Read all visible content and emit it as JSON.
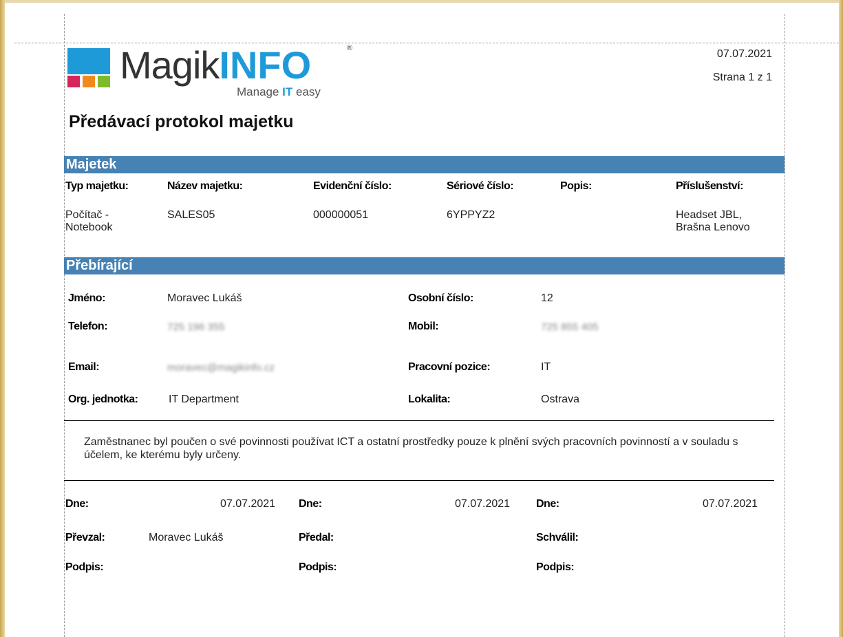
{
  "header": {
    "date": "07.07.2021",
    "page": "Strana 1 z 1"
  },
  "logo": {
    "brand_main": "Magik",
    "brand_accent": "INFO",
    "registered": "®",
    "tagline_pre": "Manage ",
    "tagline_it": "IT",
    "tagline_post": " easy",
    "colors": {
      "blue": "#1f9ad8",
      "red": "#d6245c",
      "orange": "#f08a1c",
      "green": "#7dbb2a"
    }
  },
  "title": "Předávací protokol majetku",
  "asset_section": {
    "heading": "Majetek",
    "columns": [
      "Typ majetku:",
      "Název majetku:",
      "Evidenční číslo:",
      "Sériové číslo:",
      "Popis:",
      "Příslušenství:"
    ],
    "row": {
      "type": "Počítač - Notebook",
      "name": "SALES05",
      "evidence_no": "000000051",
      "serial_no": "6YPPYZ2",
      "description": "",
      "accessories": "Headset JBL, Brašna Lenovo"
    }
  },
  "recipient_section": {
    "heading": "Přebírající",
    "name_label": "Jméno:",
    "name_value": "Moravec Lukáš",
    "personal_no_label": "Osobní číslo:",
    "personal_no_value": "12",
    "phone_label": "Telefon:",
    "phone_value": "725 196 355",
    "mobile_label": "Mobil:",
    "mobile_value": "725 855 405",
    "email_label": "Email:",
    "email_value": "moravec@magikinfo.cz",
    "position_label": "Pracovní pozice:",
    "position_value": "IT",
    "org_label": "Org. jednotka:",
    "org_value": "IT Department",
    "location_label": "Lokalita:",
    "location_value": "Ostrava"
  },
  "note": "Zaměstnanec byl poučen o své povinnosti používat ICT a ostatní prostředky pouze k plnění svých pracovních povinností a v souladu s účelem, ke kterému byly určeny.",
  "signatures": {
    "date_label": "Dne:",
    "date_value": "07.07.2021",
    "received_label": "Převzal:",
    "received_value": "Moravec Lukáš",
    "handed_label": "Předal:",
    "approved_label": "Schválil:",
    "signature_label": "Podpis:"
  }
}
